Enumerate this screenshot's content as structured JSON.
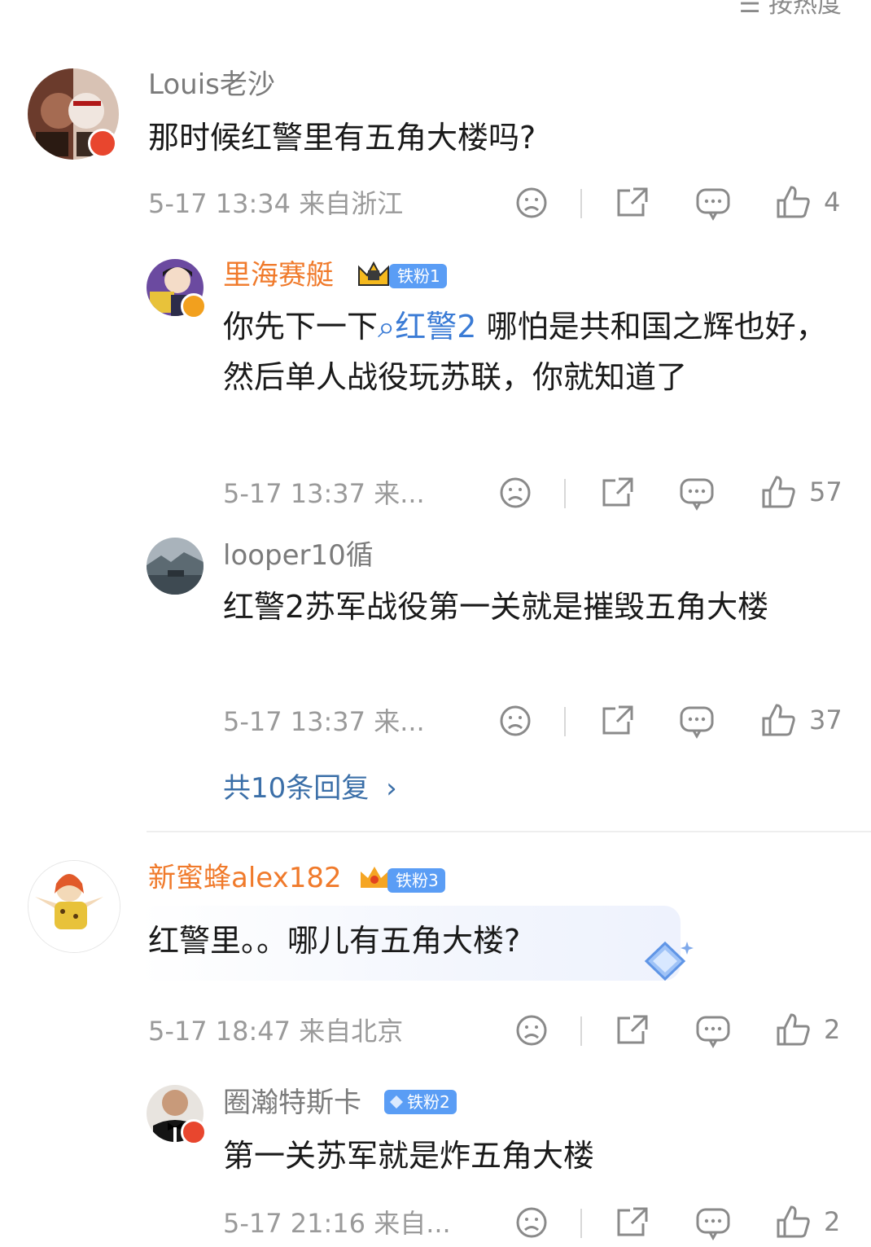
{
  "sort_label": "按热度",
  "comments": [
    {
      "username": "Louis老沙",
      "text": "那时候红警里有五角大楼吗?",
      "time": "5-17 13:34",
      "location": "来自浙江",
      "likes": "4",
      "replies": [
        {
          "username": "里海赛艇",
          "fan_badge": "铁粉1",
          "text_before": "你先下一下",
          "topic": "红警2",
          "text_after": "哪怕是共和国之辉也好，然后单人战役玩苏联，你就知道了",
          "time": "5-17 13:37",
          "location": "来...",
          "likes": "57"
        },
        {
          "username": "looper10循",
          "text": "红警2苏军战役第一关就是摧毁五角大楼",
          "time": "5-17 13:37",
          "location": "来...",
          "likes": "37"
        }
      ],
      "more_replies": "共10条回复"
    },
    {
      "username": "新蜜蜂alex182",
      "fan_badge": "铁粉3",
      "text": "红警里。。哪儿有五角大楼?",
      "time": "5-17 18:47",
      "location": "来自北京",
      "likes": "2",
      "replies": [
        {
          "username": "圈瀚特斯卡",
          "fan_badge": "铁粉2",
          "text": "第一关苏军就是炸五角大楼",
          "time": "5-17 21:16",
          "location": "来自...",
          "likes": "2"
        }
      ]
    }
  ],
  "icons": {
    "sad": "sad-face-icon",
    "share": "share-icon",
    "comment": "comment-icon",
    "like": "thumbs-up-icon",
    "more": "chevron-right-icon"
  },
  "colors": {
    "username_gray": "#7b7b7b",
    "username_vip": "#f07a2b",
    "topic_link": "#3a7bd5",
    "more_replies": "#3b6fa8",
    "fan_badge": "#5a9df5"
  }
}
